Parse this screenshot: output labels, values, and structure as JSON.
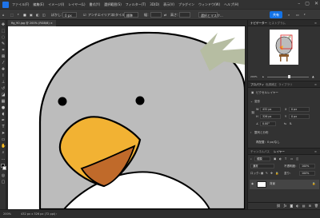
{
  "menu": {
    "items": [
      "ファイル(F)",
      "編集(E)",
      "イメージ(I)",
      "レイヤー(L)",
      "書式(Y)",
      "選択範囲(S)",
      "フィルター(T)",
      "3D(D)",
      "表示(V)",
      "プラグイン",
      "ウィンドウ(W)",
      "ヘルプ(H)"
    ]
  },
  "options": {
    "feather_label": "ぼかし：",
    "feather_value": "0 px",
    "antialias_label": "アンチエイリアス",
    "style_label": "スタイル：",
    "style_value": "標準",
    "width_label": "幅：",
    "height_label": "高さ：",
    "select_mask_label": "選択とマスク...",
    "share_label": "共有"
  },
  "document": {
    "tab_label": "fig_90.jpg @ 200% (RGB/8)"
  },
  "status": {
    "zoom": "200%",
    "doc_info": "432 px x 326 px (72 ppi)"
  },
  "navigator": {
    "tabs": [
      "ナビゲーター",
      "ヒストグラム"
    ],
    "zoom_value": "200%"
  },
  "properties": {
    "tabs": [
      "プロパティ",
      "色調補正",
      "ライブラリ"
    ],
    "pixel_layer_label": "ピクセルレイヤー",
    "transform_label": "変形",
    "w_label": "W",
    "w_value": "432 px",
    "h_label": "H",
    "h_value": "326 px",
    "x_label": "X",
    "x_value": "0 px",
    "y_label": "Y",
    "y_value": "0 px",
    "angle_value": "0.00°",
    "align_label": "整列と分布",
    "resample_label": "再配置：",
    "resample_value": "0 px/なし"
  },
  "layers": {
    "tabs": [
      "チャンネル",
      "パス",
      "レイヤー"
    ],
    "filter_label": "種類",
    "blend_mode": "通常",
    "opacity_label": "不透明度：",
    "opacity_value": "100%",
    "lock_label": "ロック：",
    "fill_label": "塗り：",
    "fill_value": "100%",
    "layer_name": "背景"
  },
  "colors": {
    "accent": "#1473e6",
    "bird_body": "#bcbcbc",
    "beak": "#f2b233",
    "mouth": "#c06a2a",
    "crest": "#b6bda2"
  }
}
